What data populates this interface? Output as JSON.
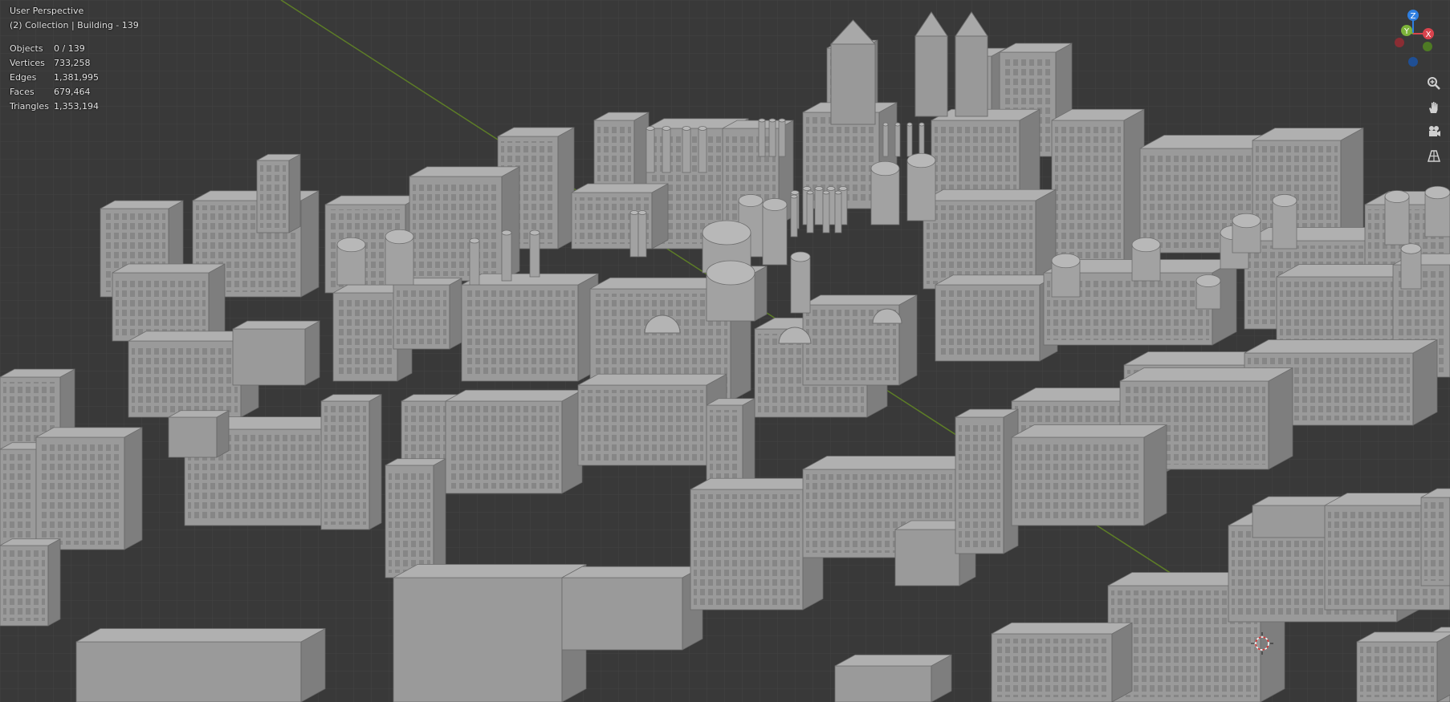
{
  "viewport": {
    "title": "User Perspective",
    "collection": "(2) Collection | Building - 139"
  },
  "stats": [
    {
      "label": "Objects",
      "value": "0 / 139"
    },
    {
      "label": "Vertices",
      "value": "733,258"
    },
    {
      "label": "Edges",
      "value": "1,381,995"
    },
    {
      "label": "Faces",
      "value": "679,464"
    },
    {
      "label": "Triangles",
      "value": "1,353,194"
    }
  ],
  "gizmo": {
    "axes": [
      {
        "label": "Z",
        "color": "#2f7fe0"
      },
      {
        "label": "Y",
        "color": "#7db33a"
      },
      {
        "label": "X",
        "color": "#d9434d"
      }
    ]
  },
  "nav_tools": [
    {
      "icon": "zoom-icon"
    },
    {
      "icon": "pan-hand-icon"
    },
    {
      "icon": "camera-icon"
    },
    {
      "icon": "grid-perspective-icon"
    }
  ],
  "colors": {
    "background": "#393939",
    "grid": "#444444",
    "x_axis_line": "#8b3a3a",
    "y_axis_line": "#6b8f2a",
    "building_face": "#9a9a9a",
    "building_top": "#b0b0b0",
    "building_side": "#7e7e7e"
  }
}
